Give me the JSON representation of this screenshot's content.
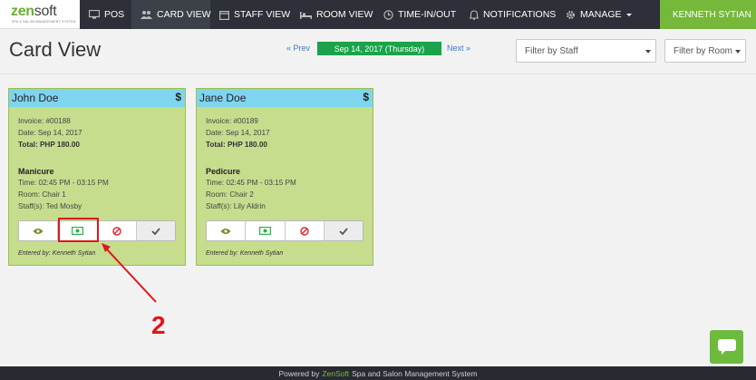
{
  "header": {
    "logo_text_main": "zen",
    "logo_text_accent": "soft",
    "logo_tagline": "SPA & SALON MANAGEMENT SYSTEM",
    "nav": [
      {
        "label": "POS",
        "icon": "monitor-icon"
      },
      {
        "label": "CARD VIEW",
        "icon": "users-icon"
      },
      {
        "label": "STAFF VIEW",
        "icon": "calendar-icon"
      },
      {
        "label": "ROOM VIEW",
        "icon": "bed-icon"
      },
      {
        "label": "TIME-IN/OUT",
        "icon": "clock-icon"
      },
      {
        "label": "NOTIFICATIONS",
        "icon": "bell-icon"
      },
      {
        "label": "MANAGE",
        "icon": "gear-icon"
      }
    ],
    "active_tab": "CARD VIEW",
    "user_name": "KENNETH SYTIAN"
  },
  "page": {
    "title": "Card View",
    "prev_label": "« Prev",
    "current_date": "Sep 14, 2017 (Thursday)",
    "next_label": "Next »",
    "filter_staff": "Filter by Staff",
    "filter_room": "Filter by Room"
  },
  "cards": [
    {
      "customer": "John Doe",
      "dollar": "$",
      "invoice": "Invoice: #00188",
      "date": "Date: Sep 14, 2017",
      "total": "Total: PHP 180.00",
      "service": "Manicure",
      "time": "Time: 02:45 PM - 03:15 PM",
      "room": "Room: Chair 1",
      "staff": "Staff(s): Ted Mosby",
      "entered_by": "Entered by: Kenneth Sytian"
    },
    {
      "customer": "Jane Doe",
      "dollar": "$",
      "invoice": "Invoice: #00189",
      "date": "Date: Sep 14, 2017",
      "total": "Total: PHP 180.00",
      "service": "Pedicure",
      "time": "Time: 02:45 PM - 03:15 PM",
      "room": "Room: Chair 2",
      "staff": "Staff(s): Lily Aldrin",
      "entered_by": "Entered by: Kenneth Sytian"
    }
  ],
  "card_actions": [
    "eye-icon",
    "money-icon",
    "cancel-icon",
    "check-icon"
  ],
  "annotation": {
    "step": "2",
    "color": "#e2141b"
  },
  "footer": {
    "prefix": "Powered by",
    "brand": "ZenSoft",
    "suffix": "Spa and Salon Management System"
  },
  "colors": {
    "nav_bg": "#2d3038",
    "user_bg": "#76b83a",
    "card_bg": "#c7dd8e",
    "card_header": "#7fd4ee",
    "date_badge": "#1aa34a"
  }
}
